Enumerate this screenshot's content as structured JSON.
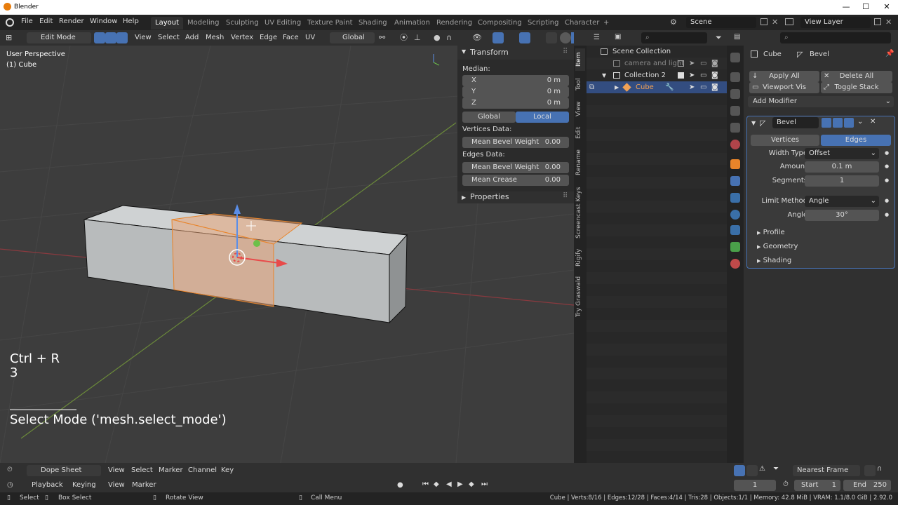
{
  "window": {
    "title": "Blender",
    "controls": [
      "—",
      "☐",
      "✕"
    ]
  },
  "topmenu": {
    "items": [
      "File",
      "Edit",
      "Render",
      "Window",
      "Help"
    ],
    "workspaces": [
      "Layout",
      "Modeling",
      "Sculpting",
      "UV Editing",
      "Texture Paint",
      "Shading",
      "Animation",
      "Rendering",
      "Compositing",
      "Scripting",
      "Character"
    ],
    "active_workspace": "Layout",
    "add_tab": "+",
    "scene": "Scene",
    "view_layer": "View Layer"
  },
  "viewport_header": {
    "mode": "Edit Mode",
    "menus": [
      "View",
      "Select",
      "Add",
      "Mesh",
      "Vertex",
      "Edge",
      "Face",
      "UV"
    ],
    "transform_orientation": "Global"
  },
  "viewport": {
    "perspective": "User Perspective",
    "object_label": "(1) Cube",
    "shortcut": "Ctrl + R",
    "shortcut_value": "3",
    "operator": "Select Mode ('mesh.select_mode')"
  },
  "npanel": {
    "transform_title": "Transform",
    "median_label": "Median:",
    "coords": [
      {
        "axis": "X",
        "value": "0 m"
      },
      {
        "axis": "Y",
        "value": "0 m"
      },
      {
        "axis": "Z",
        "value": "0 m"
      }
    ],
    "global_label": "Global",
    "local_label": "Local",
    "vertices_data_label": "Vertices Data:",
    "mean_bevel_weight_label": "Mean Bevel Weight",
    "vertex_bevel_weight": "0.00",
    "edges_data_label": "Edges Data:",
    "edge_bevel_weight": "0.00",
    "mean_crease_label": "Mean Crease",
    "mean_crease": "0.00",
    "properties_title": "Properties",
    "tabs": [
      "Item",
      "Tool",
      "View",
      "Edit",
      "Rename",
      "Screencast Keys",
      "Rigify",
      "Try Graswald"
    ]
  },
  "outliner": {
    "scene_collection": "Scene Collection",
    "rows": [
      {
        "label": "camera and light"
      },
      {
        "label": "Collection 2"
      },
      {
        "label": "Cube"
      }
    ]
  },
  "properties": {
    "object": "Cube",
    "modifier_context": "Bevel",
    "apply_all": "Apply All",
    "delete_all": "Delete All",
    "viewport_vis": "Viewport Vis",
    "toggle_stack": "Toggle Stack",
    "add_modifier": "Add Modifier",
    "modifier_name": "Bevel",
    "affect_vertices": "Vertices",
    "affect_edges": "Edges",
    "width_type_label": "Width Type",
    "width_type": "Offset",
    "amount_label": "Amount",
    "amount": "0.1 m",
    "segments_label": "Segments",
    "segments": "1",
    "limit_method_label": "Limit Method",
    "limit_method": "Angle",
    "angle_label": "Angle",
    "angle": "30°",
    "subpanels": [
      "Profile",
      "Geometry",
      "Shading"
    ]
  },
  "timeline": {
    "editor": "Dope Sheet",
    "menus": [
      "View",
      "Select",
      "Marker",
      "Channel",
      "Key"
    ],
    "snap": "Nearest Frame",
    "playback": "Playback",
    "keying": "Keying",
    "view": "View",
    "marker": "Marker",
    "current_frame": "1",
    "start_label": "Start",
    "start": "1",
    "end_label": "End",
    "end": "250"
  },
  "statusbar": {
    "select": "Select",
    "box_select": "Box Select",
    "rotate_view": "Rotate View",
    "call_menu": "Call Menu",
    "stats": "Cube | Verts:8/16 | Edges:12/28 | Faces:4/14 | Tris:28 | Objects:1/1 | Memory: 42.8 MiB | VRAM: 1.1/8.0 GiB | 2.92.0"
  },
  "colors": {
    "accent": "#4772b3",
    "selection_orange": "#e8842a",
    "object_active": "#f0a155"
  }
}
